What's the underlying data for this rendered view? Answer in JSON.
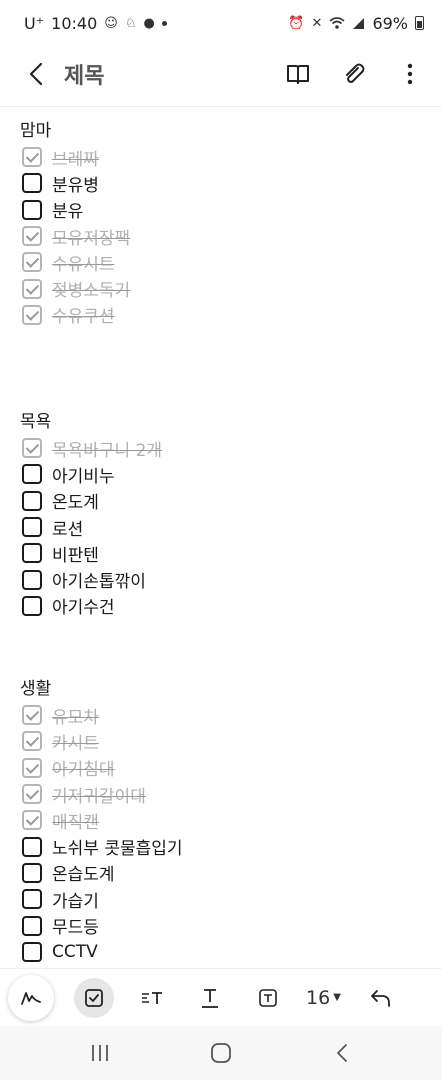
{
  "status_bar": {
    "carrier": "U⁺",
    "time": "10:40",
    "notification_icons": [
      "baby-face-icon",
      "cat-icon",
      "talk-bubble-icon",
      "dot-icon"
    ],
    "system_icons": [
      "alarm-icon",
      "mute-icon",
      "wifi-icon",
      "signal-icon"
    ],
    "battery": "69%"
  },
  "app_bar": {
    "title": "제목",
    "actions": [
      "reading-mode-icon",
      "attach-icon",
      "more-icon"
    ]
  },
  "sections": [
    {
      "heading": "맘마",
      "items": [
        {
          "label": "브레짜",
          "checked": true
        },
        {
          "label": "분유병",
          "checked": false
        },
        {
          "label": "분유",
          "checked": false
        },
        {
          "label": "모유저장팩",
          "checked": true
        },
        {
          "label": "수유시트",
          "checked": true
        },
        {
          "label": "젖병소독기",
          "checked": true
        },
        {
          "label": "수유쿠션",
          "checked": true
        }
      ]
    },
    {
      "heading": "목욕",
      "items": [
        {
          "label": "목욕바구니 2개",
          "checked": true
        },
        {
          "label": "아기비누",
          "checked": false
        },
        {
          "label": "온도계",
          "checked": false
        },
        {
          "label": "로션",
          "checked": false
        },
        {
          "label": "비판텐",
          "checked": false
        },
        {
          "label": "아기손톱깎이",
          "checked": false
        },
        {
          "label": "아기수건",
          "checked": false
        }
      ]
    },
    {
      "heading": "생활",
      "items": [
        {
          "label": "유모차",
          "checked": true
        },
        {
          "label": "카시트",
          "checked": true
        },
        {
          "label": "아기침대",
          "checked": true
        },
        {
          "label": "기저귀갈이대",
          "checked": true
        },
        {
          "label": "매직캔",
          "checked": true
        },
        {
          "label": "노쉬부 콧물흡입기",
          "checked": false
        },
        {
          "label": "온습도계",
          "checked": false
        },
        {
          "label": "가습기",
          "checked": false
        },
        {
          "label": "무드등",
          "checked": false
        },
        {
          "label": "CCTV",
          "checked": false
        }
      ]
    }
  ],
  "toolbar": {
    "font_size": "16",
    "items": [
      "handwriting-pen-icon",
      "checkbox-icon",
      "paragraph-style-icon",
      "text-style-icon",
      "text-box-icon",
      "font-size-dropdown",
      "undo-icon"
    ]
  },
  "nav_bar": {
    "items": [
      "recents-icon",
      "home-icon",
      "back-icon"
    ]
  }
}
